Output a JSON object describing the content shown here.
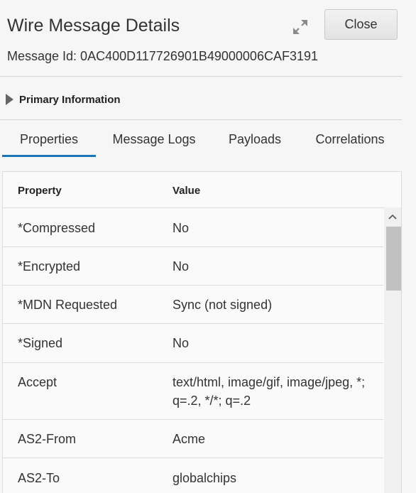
{
  "dialog": {
    "title": "Wire Message Details",
    "close_label": "Close",
    "message_id": "Message Id: 0AC400D117726901B49000006CAF3191",
    "expand_icon": "expand-arrows-icon"
  },
  "section": {
    "label": "Primary Information",
    "collapsed": true
  },
  "tabs": [
    {
      "label": "Properties",
      "active": true
    },
    {
      "label": "Message Logs",
      "active": false
    },
    {
      "label": "Payloads",
      "active": false
    },
    {
      "label": "Correlations",
      "active": false
    }
  ],
  "table": {
    "headers": {
      "property": "Property",
      "value": "Value"
    },
    "rows": [
      {
        "property": "*Compressed",
        "value": "No"
      },
      {
        "property": "*Encrypted",
        "value": "No"
      },
      {
        "property": "*MDN Requested",
        "value": "Sync (not signed)"
      },
      {
        "property": "*Signed",
        "value": "No"
      },
      {
        "property": "Accept",
        "value": "text/html, image/gif, image/jpeg, *; q=.2, */*; q=.2"
      },
      {
        "property": "AS2-From",
        "value": "Acme"
      },
      {
        "property": "AS2-To",
        "value": "globalchips"
      }
    ]
  },
  "colors": {
    "accent": "#1b76b6",
    "background": "#f6f6f6"
  }
}
